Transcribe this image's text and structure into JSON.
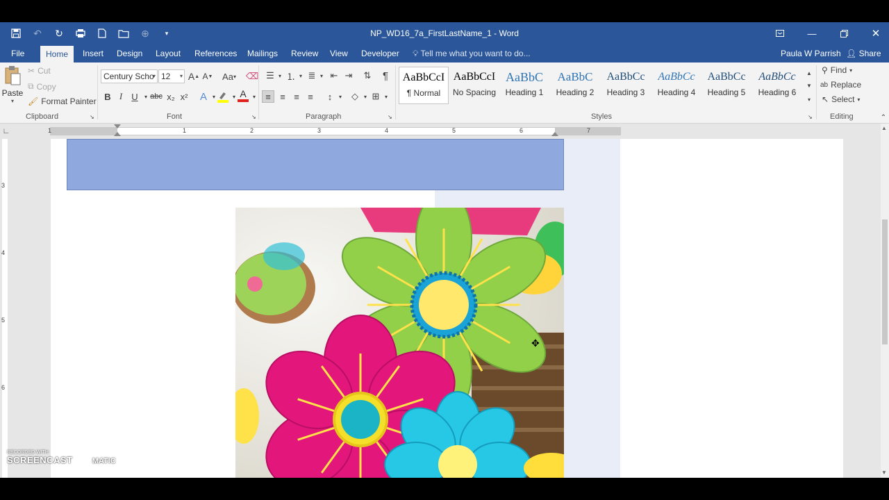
{
  "window": {
    "title": "NP_WD16_7a_FirstLastName_1 - Word"
  },
  "tabs": [
    "File",
    "Home",
    "Insert",
    "Design",
    "Layout",
    "References",
    "Mailings",
    "Review",
    "View",
    "Developer"
  ],
  "active_tab": "Home",
  "tell_me": "Tell me what you want to do...",
  "user_name": "Paula W Parrish",
  "share_label": "Share",
  "clipboard": {
    "paste": "Paste",
    "cut": "Cut",
    "copy": "Copy",
    "format_painter": "Format Painter",
    "label": "Clipboard"
  },
  "font": {
    "name": "Century Scho",
    "size": "12",
    "label": "Font",
    "bold": "B",
    "italic": "I",
    "underline": "U",
    "strike": "abc",
    "subscript": "x₂",
    "superscript": "x²",
    "change_case": "Aa",
    "grow": "A",
    "shrink": "A",
    "font_color": "A",
    "font_color_hex": "#e0201b",
    "highlight_hex": "#ffff00"
  },
  "paragraph": {
    "label": "Paragraph",
    "show_marks": "¶"
  },
  "styles": {
    "label": "Styles",
    "items": [
      {
        "preview": "AaBbCcI",
        "name": "¶ Normal"
      },
      {
        "preview": "AaBbCcI",
        "name": "No Spacing"
      },
      {
        "preview": "AaBbC",
        "name": "Heading 1"
      },
      {
        "preview": "AaBbC",
        "name": "Heading 2"
      },
      {
        "preview": "AaBbCc",
        "name": "Heading 3"
      },
      {
        "preview": "AaBbCc",
        "name": "Heading 4"
      },
      {
        "preview": "AaBbCc",
        "name": "Heading 5"
      },
      {
        "preview": "AaBbCc",
        "name": "Heading 6"
      }
    ]
  },
  "editing": {
    "label": "Editing",
    "find": "Find",
    "replace": "Replace",
    "select": "Select"
  },
  "ruler": {
    "numbers": [
      "1",
      "1",
      "2",
      "3",
      "4",
      "5",
      "6",
      "7"
    ]
  },
  "vruler_numbers": [
    "3",
    "4",
    "5",
    "6"
  ],
  "watermark": {
    "small": "RECORDED WITH",
    "big": "SCREENCAST",
    "suffix": "MATIC"
  },
  "colors": {
    "brand": "#2b579a",
    "blue_box": "#8fa9df"
  }
}
